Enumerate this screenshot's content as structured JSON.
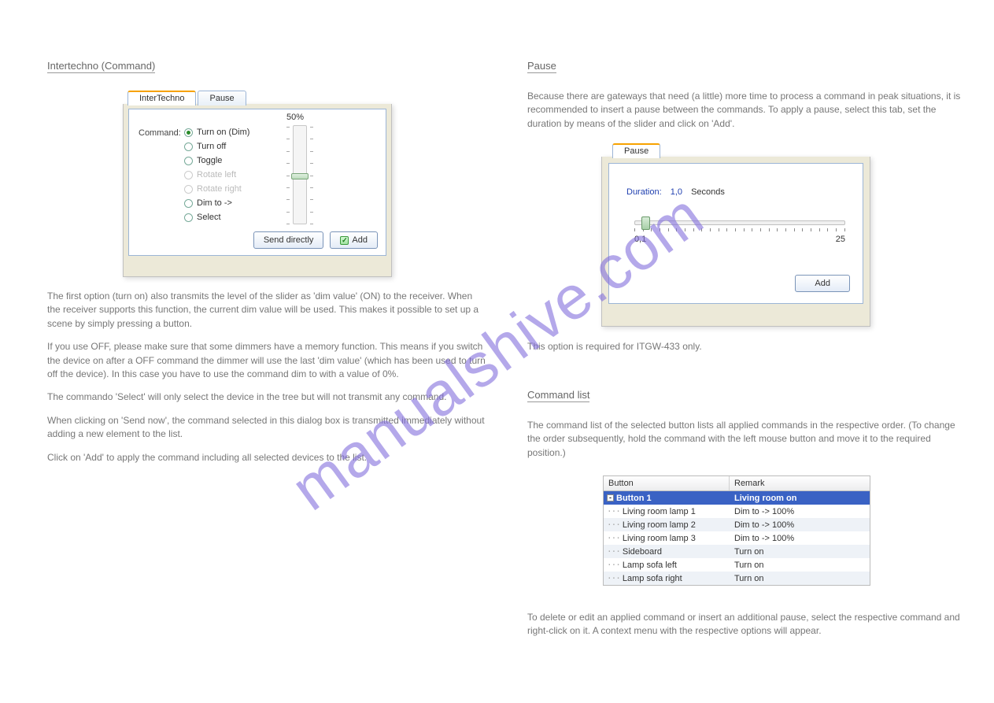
{
  "watermark": "manualshive.com",
  "sect_left_head1": "Intertechno (Command)",
  "sect_right_head1": "Pause",
  "sect_right_head2": "Command list",
  "panel1": {
    "tab_intertechno": "InterTechno",
    "tab_pause": "Pause",
    "command_label": "Command:",
    "opts": {
      "turn_on": "Turn on (Dim)",
      "turn_off": "Turn off",
      "toggle": "Toggle",
      "rotate_left": "Rotate left",
      "rotate_right": "Rotate right",
      "dim_to": "Dim to ->",
      "select": "Select"
    },
    "slider_pct": "50%",
    "btn_send": "Send directly",
    "btn_add": "Add"
  },
  "text_left_p1": "The first option (turn on) also transmits the level of the slider as 'dim value' (ON) to the receiver. When the receiver supports this function, the current dim value will be used. This makes it possible to set up a scene by simply pressing a button.",
  "text_left_p2": "If you use OFF, please make sure that some dimmers have a memory function. This means if you switch the device on after a OFF command the dimmer will use the last 'dim value' (which has been used to turn off the device). In this case you have to use the command dim to with a value of 0%.",
  "text_left_p3": "The commando 'Select' will only select the device in the tree but will not transmit any command.",
  "text_left_p4": "When clicking on 'Send now', the command selected in this dialog box is transmitted immediately without adding a new element to the list.",
  "text_left_p5": "Click on 'Add' to apply the command including all selected devices to the list.",
  "text_right_p1": "Because there are gateways that need (a little) more time to process a command in peak situations, it is recommended to insert a pause between the commands. To apply a pause, select this tab, set the duration by means of the slider and click on 'Add'.",
  "panel2": {
    "tab_pause": "Pause",
    "duration_label": "Duration:",
    "duration_value": "1,0",
    "duration_unit": "Seconds",
    "min": "0,1",
    "max": "25",
    "btn_add": "Add"
  },
  "text_right_p2": "This option is required for ITGW-433 only.",
  "text_right_p3": "The command list of the selected button lists all applied commands in the respective order. (To change the order subsequently, hold the command with the left mouse button and move it to the required position.)",
  "table": {
    "col1": "Button",
    "col2": "Remark",
    "rows": [
      {
        "b": "Button 1",
        "r": "Living room on",
        "sel": true,
        "root": true
      },
      {
        "b": "Living room lamp 1",
        "r": "Dim to -> 100%"
      },
      {
        "b": "Living room lamp 2",
        "r": "Dim to -> 100%"
      },
      {
        "b": "Living room lamp 3",
        "r": "Dim to -> 100%"
      },
      {
        "b": "Sideboard",
        "r": "Turn on"
      },
      {
        "b": "Lamp sofa left",
        "r": "Turn on"
      },
      {
        "b": "Lamp sofa right",
        "r": "Turn on"
      }
    ]
  },
  "text_right_p4": "To delete or edit an applied command or insert an additional pause, select the respective command and right-click on it. A context menu with the respective options will appear."
}
